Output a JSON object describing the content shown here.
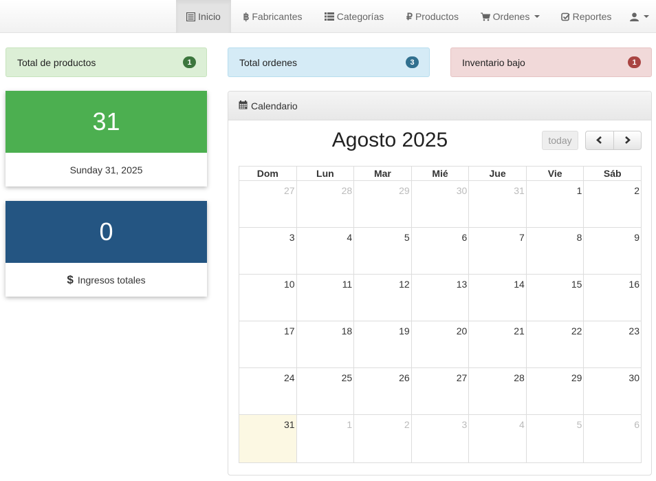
{
  "nav": {
    "inicio": "Inicio",
    "fabricantes": "Fabricantes",
    "categorias": "Categorías",
    "productos": "Productos",
    "ordenes": "Ordenes",
    "reportes": "Reportes"
  },
  "stats": {
    "productos": {
      "label": "Total de productos",
      "count": "1"
    },
    "ordenes": {
      "label": "Total ordenes",
      "count": "3"
    },
    "inventario": {
      "label": "Inventario bajo",
      "count": "1"
    }
  },
  "date_tile": {
    "day": "31",
    "label": "Sunday 31, 2025"
  },
  "income_tile": {
    "value": "0",
    "label": "Ingresos totales"
  },
  "calendar": {
    "panel_title": "Calendario",
    "title": "Agosto 2025",
    "today_label": "today",
    "weekdays": [
      "Dom",
      "Lun",
      "Mar",
      "Mié",
      "Jue",
      "Vie",
      "Sáb"
    ],
    "weeks": [
      [
        "27",
        "28",
        "29",
        "30",
        "31",
        "1",
        "2"
      ],
      [
        "3",
        "4",
        "5",
        "6",
        "7",
        "8",
        "9"
      ],
      [
        "10",
        "11",
        "12",
        "13",
        "14",
        "15",
        "16"
      ],
      [
        "17",
        "18",
        "19",
        "20",
        "21",
        "22",
        "23"
      ],
      [
        "24",
        "25",
        "26",
        "27",
        "28",
        "29",
        "30"
      ],
      [
        "31",
        "1",
        "2",
        "3",
        "4",
        "5",
        "6"
      ]
    ]
  },
  "colors": {
    "date_tile": "#4caf50",
    "income_tile": "#245582",
    "today_cell": "#fcf8e3"
  }
}
